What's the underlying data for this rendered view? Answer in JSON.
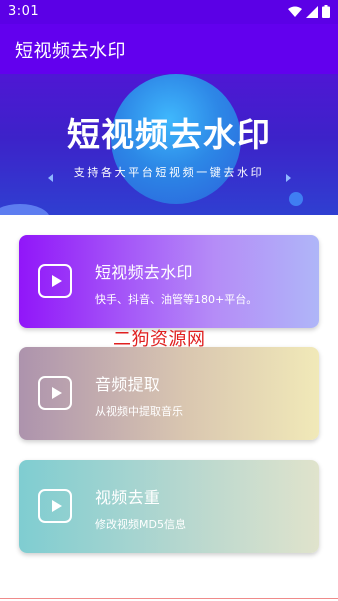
{
  "status_bar": {
    "time": "3:01",
    "icons": [
      "wifi-icon",
      "cell-signal-icon",
      "battery-icon"
    ]
  },
  "app_bar": {
    "title": "短视频去水印"
  },
  "banner": {
    "heading": "短视频去水印",
    "subtitle": "支持各大平台短视频一键去水印"
  },
  "cards": [
    {
      "title": "短视频去水印",
      "description": "快手、抖音、油管等180+平台。",
      "icon": "play-icon"
    },
    {
      "title": "音频提取",
      "description": "从视频中提取音乐",
      "icon": "play-icon"
    },
    {
      "title": "视频去重",
      "description": "修改视频MD5信息",
      "icon": "play-icon"
    }
  ],
  "watermark": "二狗资源网",
  "colors": {
    "primary": "#6200ee",
    "status_bar": "#5b00e6",
    "watermark": "#e02020"
  }
}
